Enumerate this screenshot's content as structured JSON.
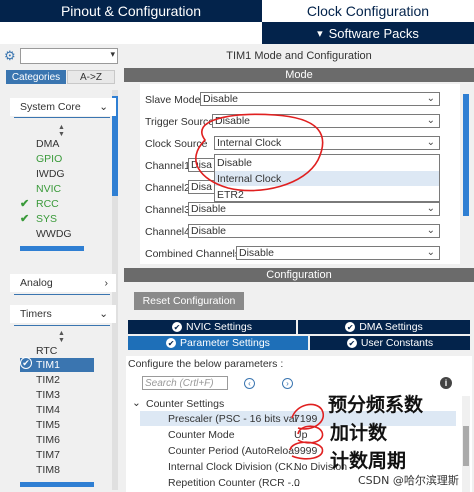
{
  "tabs": {
    "pinout": "Pinout & Configuration",
    "clock": "Clock Configuration",
    "software_packs": "Software Packs"
  },
  "left": {
    "categories_label": "Categories",
    "az_label": "A->Z",
    "system_core": {
      "title": "System Core",
      "items": [
        {
          "label": "DMA",
          "checked": false,
          "color": "#333333"
        },
        {
          "label": "GPIO",
          "checked": false,
          "color": "#3a9a3a"
        },
        {
          "label": "IWDG",
          "checked": false,
          "color": "#333333"
        },
        {
          "label": "NVIC",
          "checked": false,
          "color": "#3a9a3a"
        },
        {
          "label": "RCC",
          "checked": true,
          "color": "#3a9a3a"
        },
        {
          "label": "SYS",
          "checked": true,
          "color": "#3a9a3a"
        },
        {
          "label": "WWDG",
          "checked": false,
          "color": "#333333"
        }
      ]
    },
    "analog": {
      "title": "Analog"
    },
    "timers": {
      "title": "Timers",
      "items": [
        "RTC",
        "TIM1",
        "TIM2",
        "TIM3",
        "TIM4",
        "TIM5",
        "TIM6",
        "TIM7",
        "TIM8"
      ],
      "selected": "TIM1"
    }
  },
  "mode": {
    "window_title": "TIM1 Mode and Configuration",
    "band_label": "Mode",
    "fields": {
      "slave_mode": {
        "label": "Slave Mode",
        "value": "Disable"
      },
      "trigger_source": {
        "label": "Trigger Source",
        "value": "Disable"
      },
      "clock_source": {
        "label": "Clock Source",
        "value": "Internal Clock"
      },
      "channel1": {
        "label": "Channel1",
        "value": "Disable"
      },
      "channel2": {
        "label": "Channel2",
        "value": "Disable"
      },
      "channel3": {
        "label": "Channel3",
        "value": "Disable"
      },
      "channel4": {
        "label": "Channel4",
        "value": "Disable"
      },
      "combined_channels": {
        "label": "Combined Channels",
        "value": "Disable"
      }
    },
    "clock_source_options": [
      "Disable",
      "Internal Clock",
      "ETR2"
    ],
    "clock_source_highlighted": "Internal Clock",
    "ch1_visible": "Disa",
    "ch2_visible": "Disa"
  },
  "configuration": {
    "band_label": "Configuration",
    "reset_label": "Reset Configuration",
    "tabs": {
      "nvic": "NVIC Settings",
      "dma": "DMA Settings",
      "param": "Parameter Settings",
      "user": "User Constants"
    },
    "below_label": "Configure the below parameters :",
    "search_placeholder": "Search (Crtl+F)",
    "group_title": "Counter Settings",
    "params": [
      {
        "name": "Prescaler (PSC - 16 bits val",
        "value": "7199"
      },
      {
        "name": "Counter Mode",
        "value": "Up"
      },
      {
        "name": "Counter Period (AutoReloa",
        "value": "9999"
      },
      {
        "name": "Internal Clock Division (CK...",
        "value": "No Division"
      },
      {
        "name": "Repetition Counter (RCR -...",
        "value": "0"
      }
    ]
  },
  "annotations": {
    "prescaler_note": "预分频系数",
    "counter_note": "加计数",
    "period_note": "计数周期"
  },
  "watermark": "CSDN @哈尔滨理斯"
}
